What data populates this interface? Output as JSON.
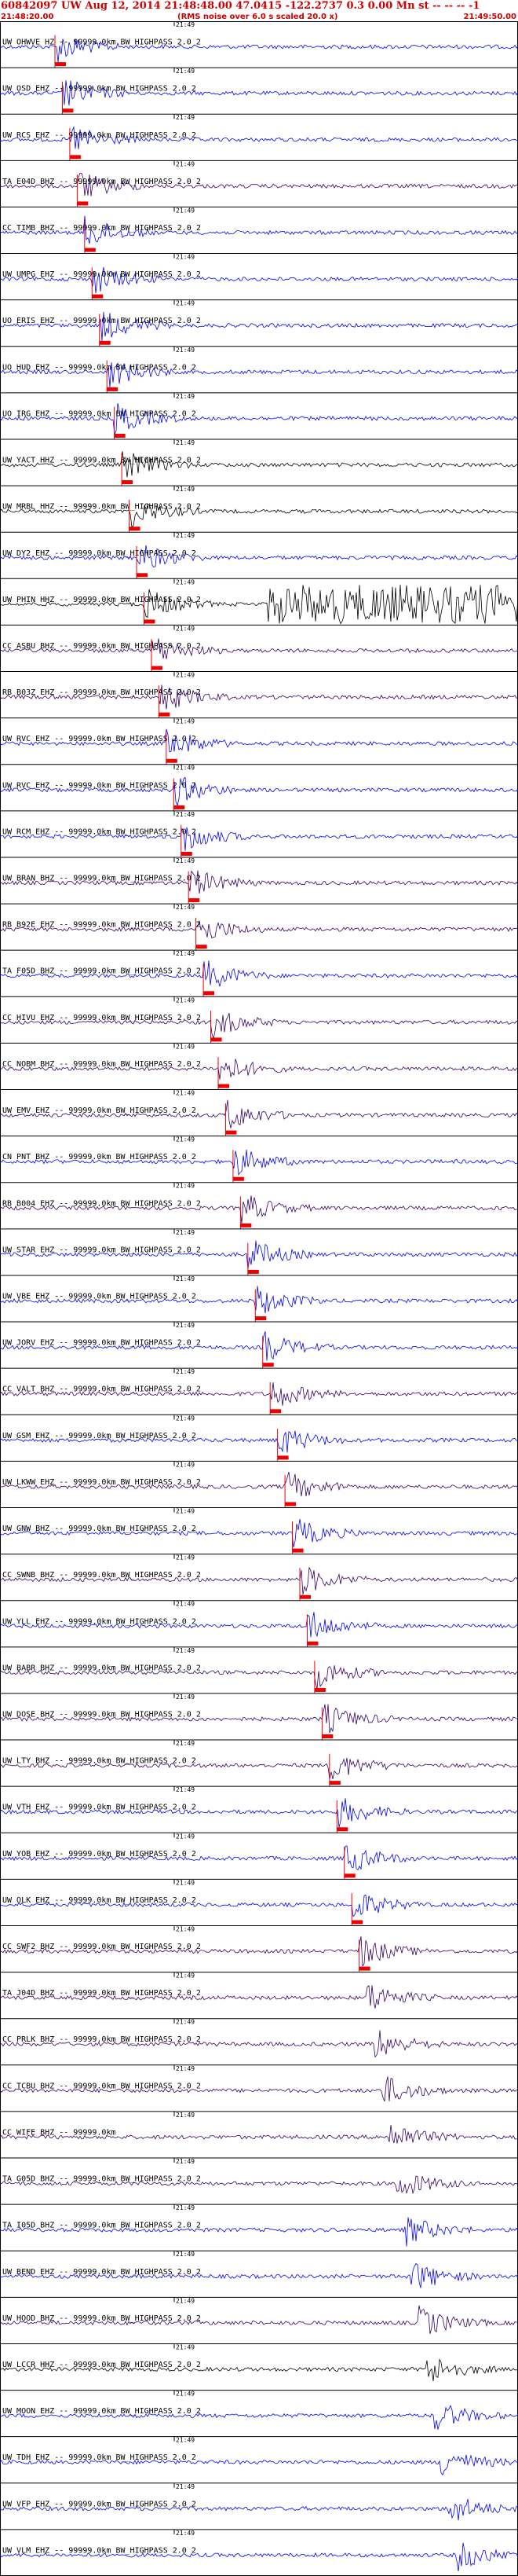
{
  "header": {
    "title": "60842097 UW Aug 12, 2014 21:48:48.00   47.0415 -122.2737   0.3 0.00 Mn st -- -- -- -1",
    "start_time": "21:48:20.00",
    "rms_note": "(RMS noise over 6.0 s scaled 20.0 x)",
    "end_time": "21:49:50.00"
  },
  "tick_label": "21:49",
  "colors": {
    "blue": "#0000ff",
    "black": "#000000",
    "purple": "#330066",
    "red": "#ee0000",
    "grid": "#000000"
  },
  "traces": [
    {
      "label": "UW OHWVE HZ -- 99999.0km BW_HIGHPASS 2.0 2",
      "color": "blue"
    },
    {
      "label": "UW OSD EHZ -- 99999.0km BW_HIGHPASS 2.0 2",
      "color": "blue"
    },
    {
      "label": "UW RCS EHZ -- 99999.0km BW_HIGHPASS 2.0 2",
      "color": "blue"
    },
    {
      "label": "TA E04D BHZ -- 99999.0km BW_HIGHPASS 2.0 2",
      "color": "purple"
    },
    {
      "label": "CC TIMB BHZ -- 99999.0km BW_HIGHPASS 2.0 2",
      "color": "blue"
    },
    {
      "label": "UW UMPG EHZ -- 99999.0km BW_HIGHPASS 2.0 2",
      "color": "blue"
    },
    {
      "label": "UO ERIS EHZ -- 99999.0km BW_HIGHPASS 2.0 2",
      "color": "blue"
    },
    {
      "label": "UO HUD EHZ -- 99999.0km BW_HIGHPASS 2.0 2",
      "color": "blue"
    },
    {
      "label": "UO IRG EHZ -- 99999.0km BW_HIGHPASS 2.0 2",
      "color": "blue"
    },
    {
      "label": "UW YACT HHZ -- 99999.0km BW_HIGHPASS 2.0 2",
      "color": "black"
    },
    {
      "label": "UW MRBL HHZ -- 99999.0km BW_HIGHPASS 2.0 2",
      "color": "black"
    },
    {
      "label": "UW DY2 EHZ -- 99999.0km BW_HIGHPASS 2.0 2",
      "color": "blue"
    },
    {
      "label": "UW PHIN HHZ -- 99999.0km BW_HIGHPASS 2.0 2",
      "color": "black"
    },
    {
      "label": "CC ASBU BHZ -- 99999.0km BW_HIGHPASS 2.0 2",
      "color": "purple"
    },
    {
      "label": "RB B03Z EHZ -- 99999.0km BW_HIGHPASS 2.0 2",
      "color": "purple"
    },
    {
      "label": "UW RVC EHZ -- 99999.0km BW_HIGHPASS 2.0 2",
      "color": "blue"
    },
    {
      "label": "UW RVC EHZ -- 99999.0km BW_HIGHPASS 2.0 2",
      "color": "blue"
    },
    {
      "label": "UW RCM EHZ -- 99999.0km BW_HIGHPASS 2.0 2",
      "color": "blue"
    },
    {
      "label": "UW BRAN BHZ -- 99999.0km BW_HIGHPASS 2.0 2",
      "color": "purple"
    },
    {
      "label": "RB B92E EHZ -- 99999.0km BW_HIGHPASS 2.0 2",
      "color": "purple"
    },
    {
      "label": "TA F05D BHZ -- 99999.0km BW_HIGHPASS 2.0 2",
      "color": "blue"
    },
    {
      "label": "CC HIVU EHZ -- 99999.0km BW_HIGHPASS 2.0 2",
      "color": "purple"
    },
    {
      "label": "CC NOBM BHZ -- 99999.0km BW_HIGHPASS 2.0 2",
      "color": "purple"
    },
    {
      "label": "UW EMV EHZ -- 99999.0km BW_HIGHPASS 2.0 2",
      "color": "purple"
    },
    {
      "label": "CN PNT BHZ -- 99999.0km BW_HIGHPASS 2.0 2",
      "color": "blue"
    },
    {
      "label": "RB B004 EHZ -- 99999.0km BW_HIGHPASS 2.0 2",
      "color": "purple"
    },
    {
      "label": "UW STAR EHZ -- 99999.0km BW_HIGHPASS 2.0 2",
      "color": "blue"
    },
    {
      "label": "UW VBE EHZ -- 99999.0km BW_HIGHPASS 2.0 2",
      "color": "blue"
    },
    {
      "label": "UW JORV EHZ -- 99999.0km BW_HIGHPASS 2.0 2",
      "color": "blue"
    },
    {
      "label": "CC VALT BHZ -- 99999.0km BW_HIGHPASS 2.0 2",
      "color": "purple"
    },
    {
      "label": "UW GSM EHZ -- 99999.0km BW_HIGHPASS 2.0 2",
      "color": "blue"
    },
    {
      "label": "UW LKWW EHZ -- 99999.0km BW_HIGHPASS 2.0 2",
      "color": "purple"
    },
    {
      "label": "UW GNW BHZ -- 99999.0km BW_HIGHPASS 2.0 2",
      "color": "blue"
    },
    {
      "label": "CC SWNB BHZ -- 99999.0km BW_HIGHPASS 2.0 2",
      "color": "purple"
    },
    {
      "label": "UW YLL EHZ -- 99999.0km BW_HIGHPASS 2.0 2",
      "color": "blue"
    },
    {
      "label": "UW BABR BHZ -- 99999.0km BW_HIGHPASS 2.0 2",
      "color": "purple"
    },
    {
      "label": "UW DOSE BHZ -- 99999.0km BW_HIGHPASS 2.0 2",
      "color": "purple"
    },
    {
      "label": "UW LTY BHZ -- 99999.0km BW_HIGHPASS 2.0 2",
      "color": "purple"
    },
    {
      "label": "UW VTH EHZ -- 99999.0km BW_HIGHPASS 2.0 2",
      "color": "blue"
    },
    {
      "label": "UW YOB EHZ -- 99999.0km BW_HIGHPASS 2.0 2",
      "color": "blue"
    },
    {
      "label": "UW OLK EHZ -- 99999.0km BW_HIGHPASS 2.0 2",
      "color": "blue"
    },
    {
      "label": "CC SWF2 BHZ -- 99999.0km BW_HIGHPASS 2.0 2",
      "color": "purple"
    },
    {
      "label": "TA J04D BHZ -- 99999.0km BW_HIGHPASS 2.0 2",
      "color": "purple"
    },
    {
      "label": "CC PRLK BHZ -- 99999.0km BW_HIGHPASS 2.0 2",
      "color": "purple"
    },
    {
      "label": "CC TCBU BHZ -- 99999.0km BW_HIGHPASS 2.0 2",
      "color": "purple"
    },
    {
      "label": "CC WIFE BHZ -- 99999.0km",
      "color": "purple"
    },
    {
      "label": "TA G05D BHZ -- 99999.0km BW_HIGHPASS 2.0 2",
      "color": "purple"
    },
    {
      "label": "TA I05D BHZ -- 99999.0km BW_HIGHPASS 2.0 2",
      "color": "blue"
    },
    {
      "label": "UW BEND EHZ -- 99999.0km BW_HIGHPASS 2.0 2",
      "color": "blue"
    },
    {
      "label": "UW HOOD BHZ -- 99999.0km BW_HIGHPASS 2.0 2",
      "color": "purple"
    },
    {
      "label": "UW LCCR HHZ -- 99999.0km BW_HIGHPASS 2.0 2",
      "color": "black"
    },
    {
      "label": "UW MOON EHZ -- 99999.0km BW_HIGHPASS 2.0 2",
      "color": "blue"
    },
    {
      "label": "UW TDH EHZ -- 99999.0km BW_HIGHPASS 2.0 2",
      "color": "blue"
    },
    {
      "label": "UW VFP EHZ -- 99999.0km BW_HIGHPASS 2.0 2",
      "color": "blue"
    },
    {
      "label": "UW VLM EHZ -- 99999.0km BW_HIGHPASS 2.0 2",
      "color": "blue"
    }
  ]
}
